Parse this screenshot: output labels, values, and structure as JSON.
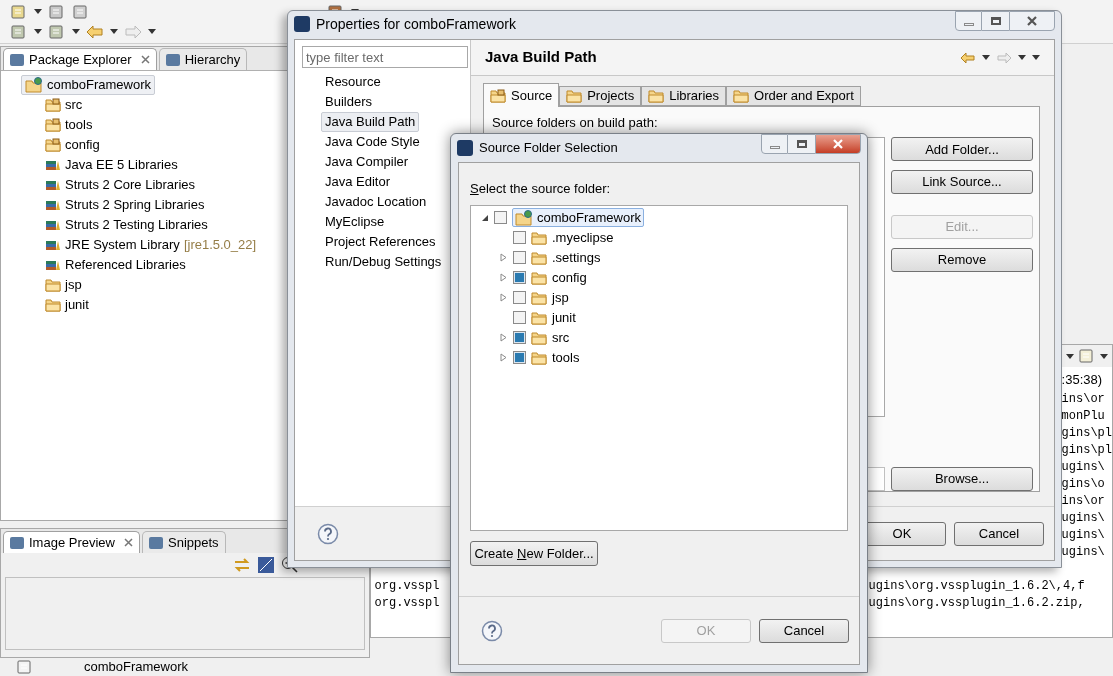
{
  "explorer": {
    "tabs": [
      {
        "label": "Package Explorer",
        "selected": true
      },
      {
        "label": "Hierarchy",
        "selected": false
      }
    ],
    "tree": {
      "label": "comboFramework",
      "kind": "project",
      "selected": true,
      "children": [
        {
          "label": "src",
          "kind": "source-folder",
          "selected": false
        },
        {
          "label": "tools",
          "kind": "source-folder",
          "selected": false
        },
        {
          "label": "config",
          "kind": "source-folder",
          "selected": false
        },
        {
          "label": "Java EE 5 Libraries",
          "kind": "library",
          "selected": false
        },
        {
          "label": "Struts 2 Core Libraries",
          "kind": "library",
          "selected": false
        },
        {
          "label": "Struts 2 Spring Libraries",
          "kind": "library",
          "selected": false
        },
        {
          "label": "Struts 2 Testing Libraries",
          "kind": "library",
          "selected": false
        },
        {
          "label": "JRE System Library",
          "kind": "library",
          "selected": false,
          "decoration": "[jre1.5.0_22]"
        },
        {
          "label": "Referenced Libraries",
          "kind": "library",
          "selected": false
        },
        {
          "label": "jsp",
          "kind": "folder",
          "selected": false
        },
        {
          "label": "junit",
          "kind": "folder",
          "selected": false
        }
      ]
    }
  },
  "preview": {
    "tabs": [
      {
        "label": "Image Preview",
        "selected": true
      },
      {
        "label": "Snippets",
        "selected": false
      }
    ]
  },
  "console": {
    "header": ":35:38)",
    "right_lines": [
      "ins\\or",
      "monPlu",
      "gins\\pl",
      "gins\\pl",
      "ugins\\",
      "gins\\o",
      "ins\\or",
      "ugins\\",
      "ugins\\",
      "ugins\\"
    ],
    "split_lines": [
      {
        "left": "org.vsspl",
        "right": "ugins\\org.vssplugin_1.6.2\\,4,f"
      },
      {
        "left": "org.vsspl",
        "right": "ugins\\org.vssplugin_1.6.2.zip,"
      }
    ]
  },
  "status_bar": {
    "text": "comboFramework"
  },
  "properties": {
    "title": "Properties for comboFramework",
    "filter_placeholder": "type filter text",
    "nav": [
      {
        "label": "Resource",
        "selected": false
      },
      {
        "label": "Builders",
        "selected": false
      },
      {
        "label": "Java Build Path",
        "selected": true
      },
      {
        "label": "Java Code Style",
        "selected": false
      },
      {
        "label": "Java Compiler",
        "selected": false
      },
      {
        "label": "Java Editor",
        "selected": false
      },
      {
        "label": "Javadoc Location",
        "selected": false
      },
      {
        "label": "MyEclipse",
        "selected": false
      },
      {
        "label": "Project References",
        "selected": false
      },
      {
        "label": "Run/Debug Settings",
        "selected": false
      }
    ],
    "page_title": "Java Build Path",
    "tabs": [
      {
        "label": "Source",
        "selected": true
      },
      {
        "label": "Projects",
        "selected": false
      },
      {
        "label": "Libraries",
        "selected": false
      },
      {
        "label": "Order and Export",
        "selected": false
      }
    ],
    "list_label": "Source folders on build path:",
    "side_buttons": [
      {
        "label": "Add Folder...",
        "disabled": false
      },
      {
        "label": "Link Source...",
        "disabled": false
      },
      {
        "label": "Edit...",
        "disabled": true
      },
      {
        "label": "Remove",
        "disabled": false
      }
    ],
    "browse": "Browse...",
    "ok": "OK",
    "cancel": "Cancel"
  },
  "source_dialog": {
    "title": "Source Folder Selection",
    "prompt": {
      "key": "S",
      "rest": "elect the source folder:"
    },
    "tree": {
      "label": "comboFramework",
      "checked": false,
      "expanded": true,
      "selected": true,
      "children": [
        {
          "label": ".myeclipse",
          "checked": false,
          "expandable": false
        },
        {
          "label": ".settings",
          "checked": false,
          "expandable": true
        },
        {
          "label": "config",
          "checked": true,
          "expandable": true
        },
        {
          "label": "jsp",
          "checked": false,
          "expandable": true
        },
        {
          "label": "junit",
          "checked": false,
          "expandable": false
        },
        {
          "label": "src",
          "checked": true,
          "expandable": true
        },
        {
          "label": "tools",
          "checked": true,
          "expandable": true
        }
      ]
    },
    "create_button": {
      "before": "Create ",
      "key": "N",
      "rest": "ew Folder..."
    },
    "ok": {
      "label": "OK",
      "disabled": true
    },
    "cancel": "Cancel"
  }
}
